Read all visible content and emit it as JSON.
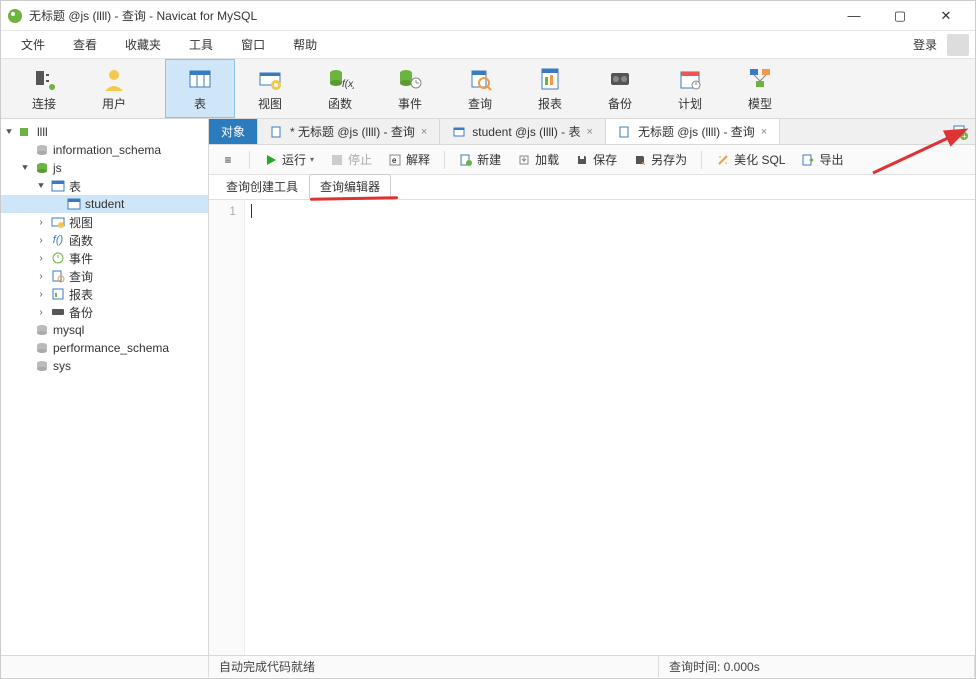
{
  "window": {
    "title": "无标题 @js (llll) - 查询 - Navicat for MySQL"
  },
  "menu": {
    "items": [
      "文件",
      "查看",
      "收藏夹",
      "工具",
      "窗口",
      "帮助"
    ],
    "login": "登录"
  },
  "toolbar": {
    "items": [
      {
        "label": "连接",
        "icon": "plug"
      },
      {
        "label": "用户",
        "icon": "user"
      },
      {
        "label": "表",
        "icon": "table",
        "active": true
      },
      {
        "label": "视图",
        "icon": "view"
      },
      {
        "label": "函数",
        "icon": "fx"
      },
      {
        "label": "事件",
        "icon": "event"
      },
      {
        "label": "查询",
        "icon": "query"
      },
      {
        "label": "报表",
        "icon": "report"
      },
      {
        "label": "备份",
        "icon": "backup"
      },
      {
        "label": "计划",
        "icon": "schedule"
      },
      {
        "label": "模型",
        "icon": "model"
      }
    ]
  },
  "tree": {
    "root": "llll",
    "dbs": [
      {
        "name": "information_schema"
      },
      {
        "name": "js",
        "expanded": true,
        "children": [
          {
            "name": "表",
            "icon": "table",
            "expanded": true,
            "children": [
              {
                "name": "student",
                "icon": "table",
                "selected": true
              }
            ]
          },
          {
            "name": "视图",
            "icon": "view"
          },
          {
            "name": "函数",
            "icon": "fx"
          },
          {
            "name": "事件",
            "icon": "event"
          },
          {
            "name": "查询",
            "icon": "query"
          },
          {
            "name": "报表",
            "icon": "report"
          },
          {
            "name": "备份",
            "icon": "backup"
          }
        ]
      },
      {
        "name": "mysql"
      },
      {
        "name": "performance_schema"
      },
      {
        "name": "sys"
      }
    ]
  },
  "doc_tabs": {
    "tabs": [
      {
        "label": "对象",
        "active_blue": true
      },
      {
        "label": "* 无标题 @js (llll) - 查询",
        "icon": "query"
      },
      {
        "label": "student @js (llll) - 表",
        "icon": "table"
      },
      {
        "label": "无标题 @js (llll) - 查询",
        "icon": "query",
        "active_white": true
      }
    ]
  },
  "query_toolbar": {
    "menu_icon": "≡",
    "run": "运行",
    "stop": "停止",
    "explain": "解释",
    "new": "新建",
    "load": "加载",
    "save": "保存",
    "save_as": "另存为",
    "beautify": "美化 SQL",
    "export": "导出"
  },
  "sub_tabs": {
    "builder": "查询创建工具",
    "editor": "查询编辑器"
  },
  "editor": {
    "first_line_no": "1"
  },
  "status": {
    "msg": "自动完成代码就绪",
    "time": "查询时间: 0.000s"
  }
}
